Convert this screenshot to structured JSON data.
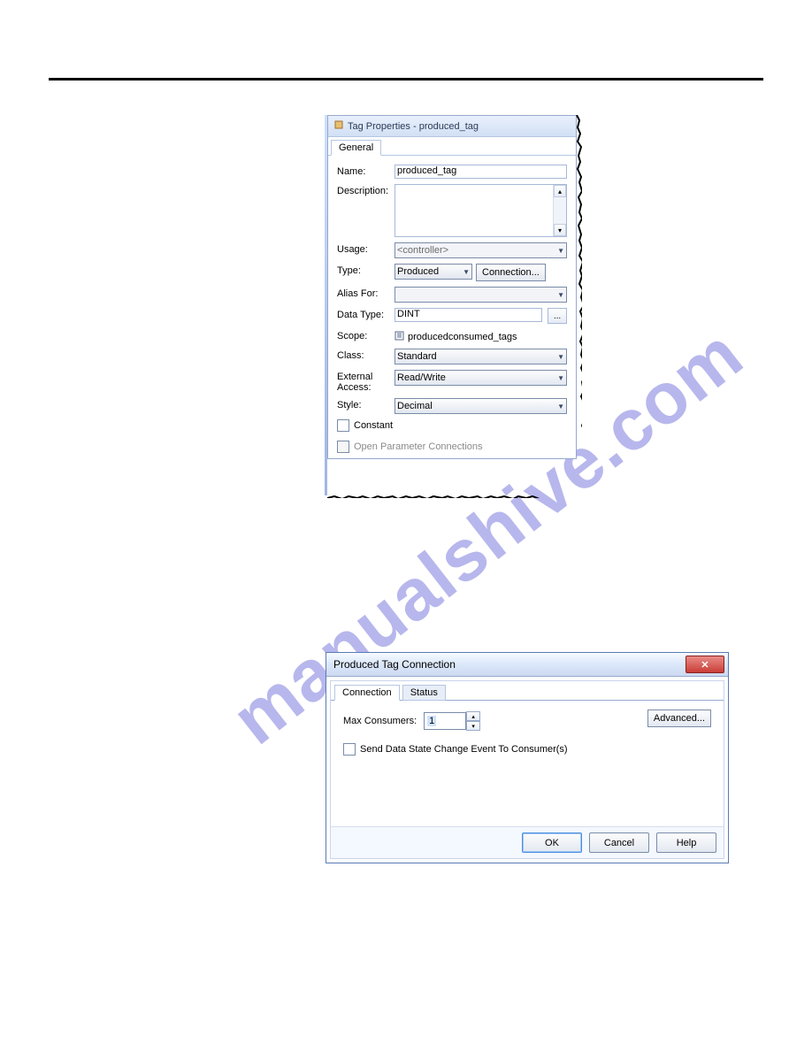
{
  "watermark": "manualshive.com",
  "dialog1": {
    "title": "Tag Properties - produced_tag",
    "tab": "General",
    "name_lbl": "Name:",
    "name_val": "produced_tag",
    "desc_lbl": "Description:",
    "usage_lbl": "Usage:",
    "usage_val": "<controller>",
    "type_lbl": "Type:",
    "type_val": "Produced",
    "conn_btn": "Connection...",
    "alias_lbl": "Alias For:",
    "datatype_lbl": "Data Type:",
    "datatype_val": "DINT",
    "scope_lbl": "Scope:",
    "scope_val": "producedconsumed_tags",
    "class_lbl": "Class:",
    "class_val": "Standard",
    "ext_lbl": "External Access:",
    "ext_val": "Read/Write",
    "style_lbl": "Style:",
    "style_val": "Decimal",
    "constant_lbl": "Constant",
    "openparam_lbl": "Open Parameter Connections"
  },
  "dialog2": {
    "title": "Produced Tag Connection",
    "tab1": "Connection",
    "tab2": "Status",
    "maxcons_lbl": "Max Consumers:",
    "maxcons_val": "1",
    "advanced_btn": "Advanced...",
    "send_lbl": "Send Data State Change Event To Consumer(s)",
    "ok_btn": "OK",
    "cancel_btn": "Cancel",
    "help_btn": "Help"
  }
}
